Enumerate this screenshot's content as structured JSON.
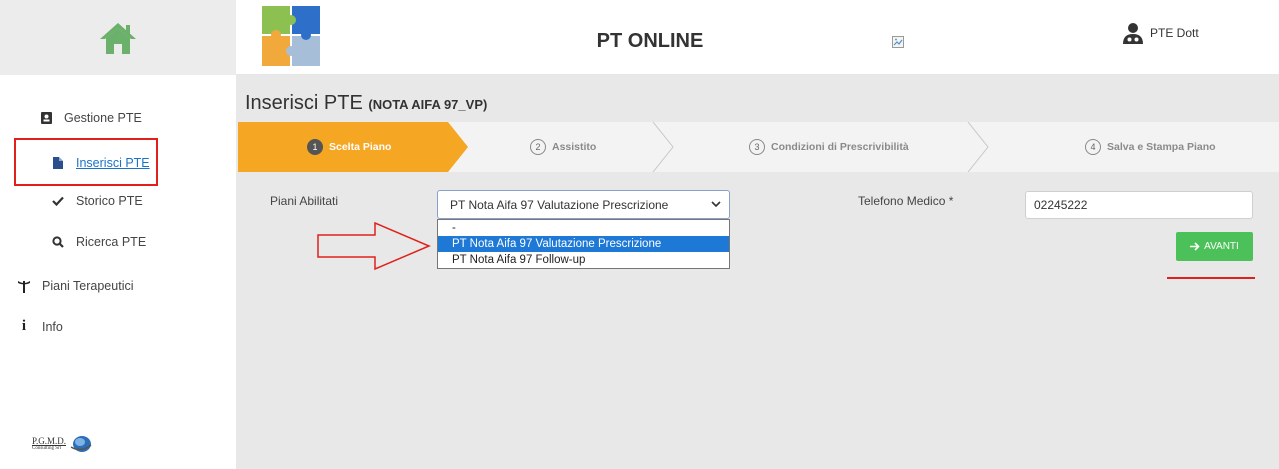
{
  "header": {
    "app_title": "PT ONLINE",
    "user_name": "PTE Dott",
    "icons": [
      "home-icon",
      "puzzle-logo-icon",
      "broken-image-icon",
      "user-doctor-icon"
    ]
  },
  "sidebar": {
    "items": [
      {
        "label": "Gestione PTE",
        "icon": "address-book-icon"
      },
      {
        "label": "Inserisci PTE",
        "icon": "file-icon"
      },
      {
        "label": "Storico PTE",
        "icon": "check-icon"
      },
      {
        "label": "Ricerca PTE",
        "icon": "search-icon"
      },
      {
        "label": "Piani Terapeutici",
        "icon": "caduceus-icon"
      },
      {
        "label": "Info",
        "icon": "info-icon"
      }
    ],
    "footer_logo_line1": "P.G.M.D.",
    "footer_logo_line2": "Consulting Srl"
  },
  "main": {
    "title": "Inserisci PTE",
    "title_sub": "(NOTA AIFA 97_VP)",
    "steps": [
      {
        "num": "1",
        "label": "Scelta Piano",
        "active": true
      },
      {
        "num": "2",
        "label": "Assistito",
        "active": false
      },
      {
        "num": "3",
        "label": "Condizioni di Prescrivibilità",
        "active": false
      },
      {
        "num": "4",
        "label": "Salva e Stampa Piano",
        "active": false
      }
    ],
    "piani_label": "Piani Abilitati",
    "piani_selected": "PT Nota Aifa 97 Valutazione Prescrizione",
    "piani_options": [
      "-",
      "PT Nota Aifa 97 Valutazione Prescrizione",
      "PT Nota Aifa 97 Follow-up"
    ],
    "telefono_label": "Telefono Medico *",
    "telefono_value": "02245222",
    "avanti_label": "AVANTI"
  },
  "colors": {
    "active_step": "#f5a623",
    "button_green": "#4cc159",
    "annotation_red": "#e0201b",
    "link_blue": "#1a73c9",
    "dropdown_highlight": "#1e78d6"
  }
}
